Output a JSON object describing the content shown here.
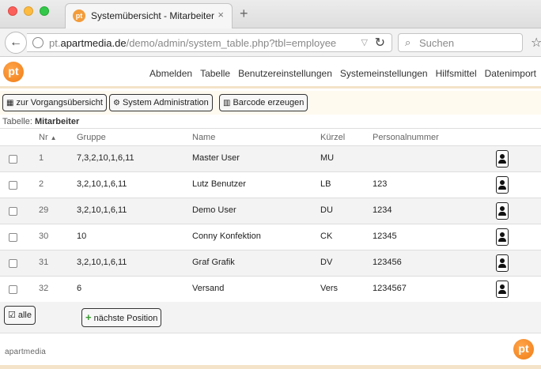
{
  "browser": {
    "tab_favicon": "pt",
    "tab_title": "Systemübersicht - Mitarbeiter",
    "tab_close": "×",
    "new_tab": "+",
    "url_prefix": "pt.",
    "url_domain": "apartmedia.de",
    "url_path": "/demo/admin/system_table.php?tbl=employee",
    "search_placeholder": "Suchen"
  },
  "app": {
    "logo_text": "pt",
    "nav": [
      "Abmelden",
      "Tabelle",
      "Benutzereinstellungen",
      "Systemeinstellungen",
      "Hilfsmittel",
      "Datenimport"
    ],
    "actions": {
      "vorgang": "zur Vorgangsübersicht",
      "sysadmin": "System Administration",
      "barcode": "Barcode erzeugen"
    },
    "caption_prefix": "Tabelle:",
    "caption_name": "Mitarbeiter"
  },
  "table": {
    "headers": {
      "nr": "Nr",
      "sort_indicator": "▲",
      "gruppe": "Gruppe",
      "name": "Name",
      "kuerzel": "Kürzel",
      "personalnummer": "Personalnummer"
    },
    "rows": [
      {
        "nr": "1",
        "gruppe": "7,3,2,10,1,6,11",
        "name": "Master User",
        "kuerzel": "MU",
        "personalnummer": ""
      },
      {
        "nr": "2",
        "gruppe": "3,2,10,1,6,11",
        "name": "Lutz Benutzer",
        "kuerzel": "LB",
        "personalnummer": "123"
      },
      {
        "nr": "29",
        "gruppe": "3,2,10,1,6,11",
        "name": "Demo User",
        "kuerzel": "DU",
        "personalnummer": "1234"
      },
      {
        "nr": "30",
        "gruppe": "10",
        "name": "Conny Konfektion",
        "kuerzel": "CK",
        "personalnummer": "12345"
      },
      {
        "nr": "31",
        "gruppe": "3,2,10,1,6,11",
        "name": "Graf Grafik",
        "kuerzel": "DV",
        "personalnummer": "123456"
      },
      {
        "nr": "32",
        "gruppe": "6",
        "name": "Versand",
        "kuerzel": "Vers",
        "personalnummer": "1234567"
      }
    ]
  },
  "footer": {
    "all_label": "alle",
    "next_label": "nächste Position",
    "brand": "apartmedia",
    "logo_text": "pt"
  },
  "colors": {
    "accent": "#f07d16",
    "header_underline": "#f4e3c8",
    "row_alt": "#f3f3f3",
    "plus_green": "#3a9a32"
  }
}
